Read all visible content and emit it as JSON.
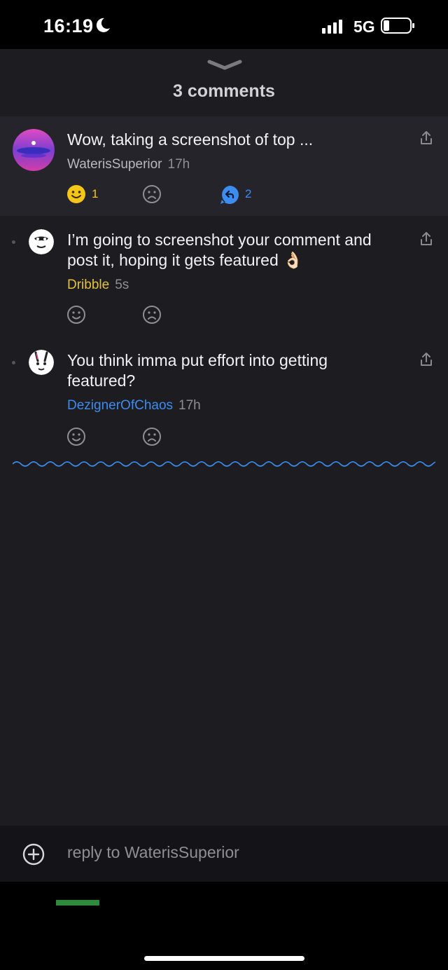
{
  "status_bar": {
    "time": "16:19",
    "network": "5G",
    "icons": [
      "moon-icon",
      "signal-icon",
      "battery-icon"
    ]
  },
  "sheet": {
    "title": "3 comments",
    "icons": [
      "chevron-down-icon"
    ]
  },
  "comments": [
    {
      "text": "Wow, taking a screenshot of top ...",
      "author": "WaterisSuperior",
      "author_color": "#b8b8be",
      "age": "17h",
      "happy_count": "1",
      "reply_count": "2",
      "icons": [
        "share-icon",
        "smiley-icon",
        "frown-icon",
        "reply-icon"
      ]
    },
    {
      "text": "I’m going to screenshot your comment and post it, hoping it gets featured 👌🏻",
      "author": "Dribble",
      "author_color": "#e3c13b",
      "age": "5s",
      "icons": [
        "share-icon",
        "smiley-icon",
        "frown-icon"
      ]
    },
    {
      "text": "You think imma put effort into getting featured?",
      "author": "DezignerOfChaos",
      "author_color": "#3d8cf0",
      "age": "17h",
      "icons": [
        "share-icon",
        "smiley-icon",
        "frown-icon"
      ]
    }
  ],
  "reply_bar": {
    "placeholder": "reply to WaterisSuperior",
    "icons": [
      "add-icon"
    ]
  },
  "colors": {
    "background": "#1c1c21",
    "highlight_row": "#24242a",
    "accent_blue": "#3d8cf0",
    "accent_yellow": "#f5c518"
  }
}
